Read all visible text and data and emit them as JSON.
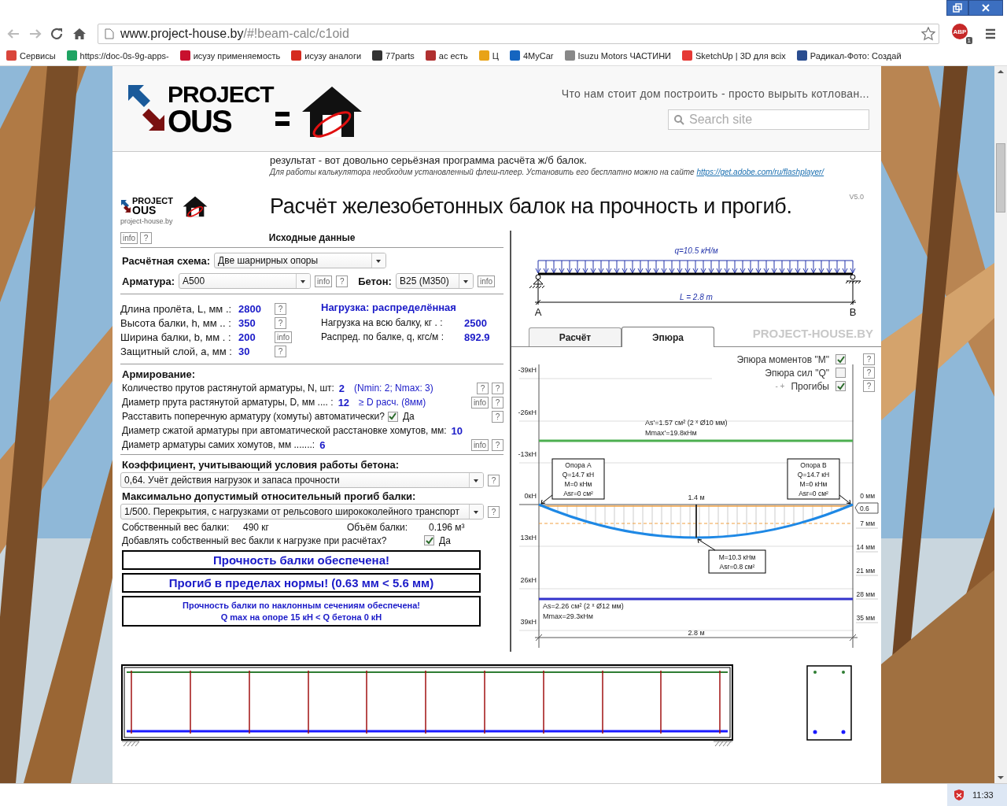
{
  "browser": {
    "url_host": "www.project-house.by",
    "url_path": "/#!beam-calc/c1oid",
    "abp_label": "ABP",
    "abp_badge": "1",
    "bookmarks": [
      {
        "label": "Сервисы",
        "color": "#d9453b"
      },
      {
        "label": "https://doc-0s-9g-apps-",
        "color": "#1fa463"
      },
      {
        "label": "исузу применяемость",
        "color": "#c8102e"
      },
      {
        "label": "исузу аналоги",
        "color": "#d52b1e"
      },
      {
        "label": "77parts",
        "color": "#333333"
      },
      {
        "label": "ас есть",
        "color": "#b03030"
      },
      {
        "label": "Ц",
        "color": "#e8a317"
      },
      {
        "label": "4MyCar",
        "color": "#1565c0"
      },
      {
        "label": "Isuzu Motors ЧАСТИНИ",
        "color": "#888888"
      },
      {
        "label": "SketchUp | 3D для всіх",
        "color": "#e53935"
      },
      {
        "label": "Радикал-Фото: Создай",
        "color": "#2a4d8f"
      }
    ]
  },
  "site": {
    "logo_top": "PROJECT",
    "logo_bottom": "OUS",
    "tagline": "Что нам стоит дом построить - просто вырыть котлован...",
    "search_placeholder": "Search site",
    "intro": "результат - вот довольно серьёзная программа расчёта ж/б балок.",
    "flash_note": "Для работы калькулятора необходим установленный флеш-плеер. Установить его бесплатно можно на сайте",
    "flash_link": "https://get.adobe.com/ru/flashplayer/"
  },
  "calc": {
    "small_logo": {
      "top": "PROJECT",
      "bottom": "OUS",
      "site": "project-house.by"
    },
    "title": "Расчёт железобетонных балок на прочность и прогиб.",
    "version": "V5.0",
    "header_buttons": [
      "info",
      "?"
    ],
    "section_title": "Исходные данные",
    "scheme": {
      "label": "Расчётная схема:",
      "value": "Две шарнирных опоры"
    },
    "rebar": {
      "label": "Арматура:",
      "value": "A500",
      "buttons": [
        "info",
        "?"
      ]
    },
    "concrete": {
      "label": "Бетон:",
      "value": "B25 (M350)",
      "buttons": [
        "info"
      ]
    },
    "dims": [
      {
        "label": "Длина пролёта, L, мм .:",
        "value": "2800",
        "button": "?"
      },
      {
        "label": "Высота балки, h, мм .. :",
        "value": "350",
        "button": "?"
      },
      {
        "label": "Ширина балки, b, мм . :",
        "value": "200",
        "button": "info"
      },
      {
        "label": "Защитный слой, a, мм :",
        "value": "30",
        "button": "?"
      }
    ],
    "load": {
      "title": "Нагрузка: распределённая",
      "rows": [
        {
          "label": "Нагрузка на всю балку, кг . :",
          "value": "2500"
        },
        {
          "label": "Распред. по балке, q, кгс/м :",
          "value": "892.9"
        }
      ]
    },
    "reinforcement": {
      "title": "Армирование:",
      "rows": [
        {
          "kind": "value",
          "label": "Количество прутов растянутой арматуры, N, шт:",
          "value": "2",
          "note": "(Nmin: 2;  Nmax: 3)",
          "buttons": [
            "?",
            "?"
          ]
        },
        {
          "kind": "value",
          "label": "Диаметр прута растянутой арматуры, D, мм .... :",
          "value": "12",
          "note": "≥ D расч. (8мм)",
          "buttons": [
            "info",
            "?"
          ]
        },
        {
          "kind": "checkbox",
          "label": "Расставить поперечную арматуру (хомуты) автоматически?",
          "checked": true,
          "check_label": "Да",
          "buttons": [
            "?"
          ]
        },
        {
          "kind": "value",
          "label": "Диаметр сжатой арматуры при автоматической расстановке хомутов, мм:",
          "value": "10"
        },
        {
          "kind": "value",
          "label": "Диаметр арматуры самих хомутов, мм .......:",
          "value": "6",
          "buttons": [
            "info",
            "?"
          ]
        }
      ]
    },
    "coef": {
      "title": "Коэффициент, учитывающий условия работы бетона:",
      "value": "0,64. Учёт действия нагрузок и запаса прочности",
      "button": "?"
    },
    "deflection_limit": {
      "title": "Максимально допустимый относительный прогиб балки:",
      "value": "1/500. Перекрытия, с нагрузками от рельсового ширококолейного транспорт",
      "button": "?"
    },
    "self_weight": {
      "label": "Собственный вес балки:",
      "value": "490 кг",
      "volume_label": "Объём балки:",
      "volume_value": "0.196 м³",
      "add_label": "Добавлять собственный вес бакли к нагрузке при расчётах?",
      "add_checked": true,
      "add_check_label": "Да"
    },
    "results": [
      {
        "kind": "large",
        "lines": [
          "Прочность балки обеспечена!"
        ]
      },
      {
        "kind": "large",
        "lines": [
          "Прогиб в пределах нормы!    (0.63 мм < 5.6 мм)"
        ]
      },
      {
        "kind": "small",
        "lines": [
          "Прочность балки по наклонным сечениям обеспечена!",
          "Q max на опоре 15 кН < Q бетона 0 кН"
        ]
      }
    ],
    "load_scheme": {
      "q_label": "q=10.5 кН/м",
      "span_label": "L = 2.8 m",
      "support_a": "A",
      "support_b": "B"
    },
    "tabs": [
      {
        "label": "Расчёт",
        "selected": false
      },
      {
        "label": "Эпюра",
        "selected": true
      }
    ],
    "brand_label": "PROJECT-HOUSE.BY",
    "diagram": {
      "toggles": [
        {
          "label": "Эпюра моментов \"M\"",
          "checked": true,
          "button": "?"
        },
        {
          "label": "Эпюра сил \"Q\"",
          "checked": false,
          "button": "?"
        },
        {
          "label": "Прогибы",
          "legend": "- +",
          "checked": true,
          "button": "?"
        }
      ],
      "force_ticks": [
        "-39кН",
        "-26кН",
        "-13кН",
        "0кН",
        "13кН",
        "26кН",
        "39кН"
      ],
      "mm_ticks": [
        "0 мм",
        "7 мм",
        "14 мм",
        "21 мм",
        "28 мм",
        "35 мм"
      ],
      "deflection_value": "0.6",
      "top_rebar": [
        "As'=1.57 см² (2 ˣ Ø10 мм)",
        "Mmax'=19.8кНм"
      ],
      "bottom_rebar": [
        "As=2.26 см² (2 ˣ Ø12 мм)",
        "Mmax=29.3кНм"
      ],
      "support_a": [
        "Опора A",
        "Q=14.7 кН",
        "M=0 кНм",
        "Asr=0 см²"
      ],
      "support_b": [
        "Опора B",
        "Q=14.7 кН",
        "M=0 кНм",
        "Asr=0 см²"
      ],
      "mid_label": "1.4 м",
      "mid_box": [
        "M=10.3 кНм",
        "Asr=0.8 см²"
      ],
      "span": "2.8 м"
    }
  },
  "status": {
    "clock": "11:33"
  }
}
